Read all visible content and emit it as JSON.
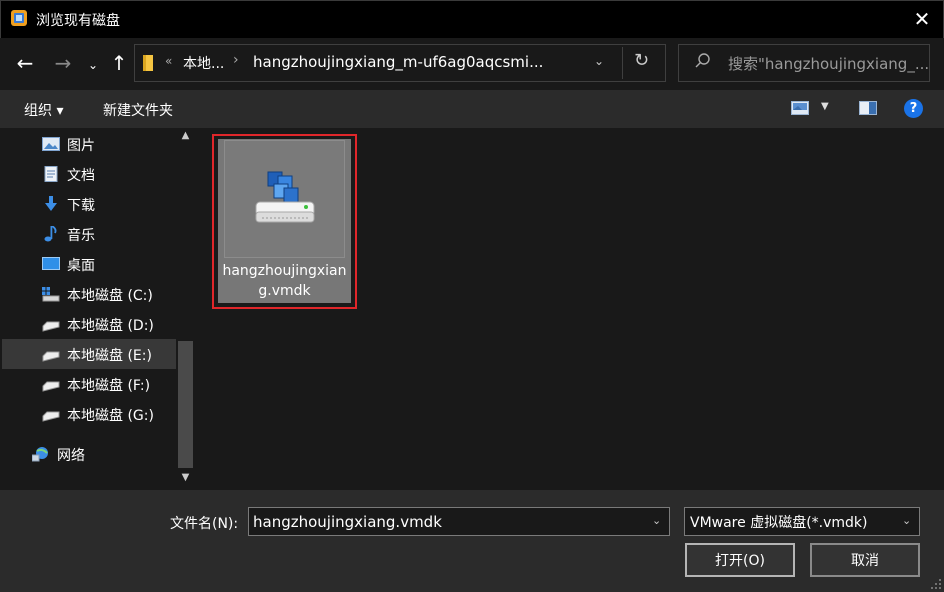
{
  "window": {
    "title": "浏览现有磁盘",
    "close_glyph": "✕"
  },
  "nav": {
    "back_glyph": "←",
    "forward_glyph": "→",
    "recent_glyph": "⌄",
    "up_glyph": "↑",
    "address": {
      "overflow_glyph": "«",
      "part1": "本地...",
      "separator": "›",
      "part2": "hangzhoujingxiang_m-uf6ag0aqcsmi...",
      "dropdown_glyph": "⌄",
      "refresh_glyph": "↻"
    },
    "search_placeholder": "搜索\"hangzhoujingxiang_..."
  },
  "toolbar": {
    "organize_label": "组织 ▾",
    "new_folder_label": "新建文件夹",
    "view_dropdown_glyph": "▼",
    "help_label": "?"
  },
  "sidebar": {
    "items": [
      {
        "label": "图片",
        "icon": "pictures-icon"
      },
      {
        "label": "文档",
        "icon": "documents-icon"
      },
      {
        "label": "下载",
        "icon": "downloads-icon"
      },
      {
        "label": "音乐",
        "icon": "music-icon"
      },
      {
        "label": "桌面",
        "icon": "desktop-icon"
      },
      {
        "label": "本地磁盘 (C:)",
        "icon": "system-drive-icon"
      },
      {
        "label": "本地磁盘 (D:)",
        "icon": "drive-icon"
      },
      {
        "label": "本地磁盘 (E:)",
        "icon": "drive-icon",
        "selected": true
      },
      {
        "label": "本地磁盘 (F:)",
        "icon": "drive-icon"
      },
      {
        "label": "本地磁盘 (G:)",
        "icon": "drive-icon"
      },
      {
        "label": "网络",
        "icon": "network-icon"
      }
    ],
    "scroll_up_glyph": "▲",
    "scroll_down_glyph": "▼"
  },
  "files": [
    {
      "name": "hangzhoujingxiang.vmdk",
      "icon": "vmdk-disk-icon",
      "selected": true
    }
  ],
  "footer": {
    "filename_label": "文件名(N):",
    "filename_value": "hangzhoujingxiang.vmdk",
    "filetype_value": "VMware 虚拟磁盘(*.vmdk)",
    "dropdown_glyph": "⌄",
    "open_label": "打开(O)",
    "cancel_label": "取消"
  },
  "colors": {
    "accent_highlight": "#e0262a",
    "help_blue": "#1a73e8",
    "background": "#191919",
    "toolbar": "#2b2b2b"
  }
}
